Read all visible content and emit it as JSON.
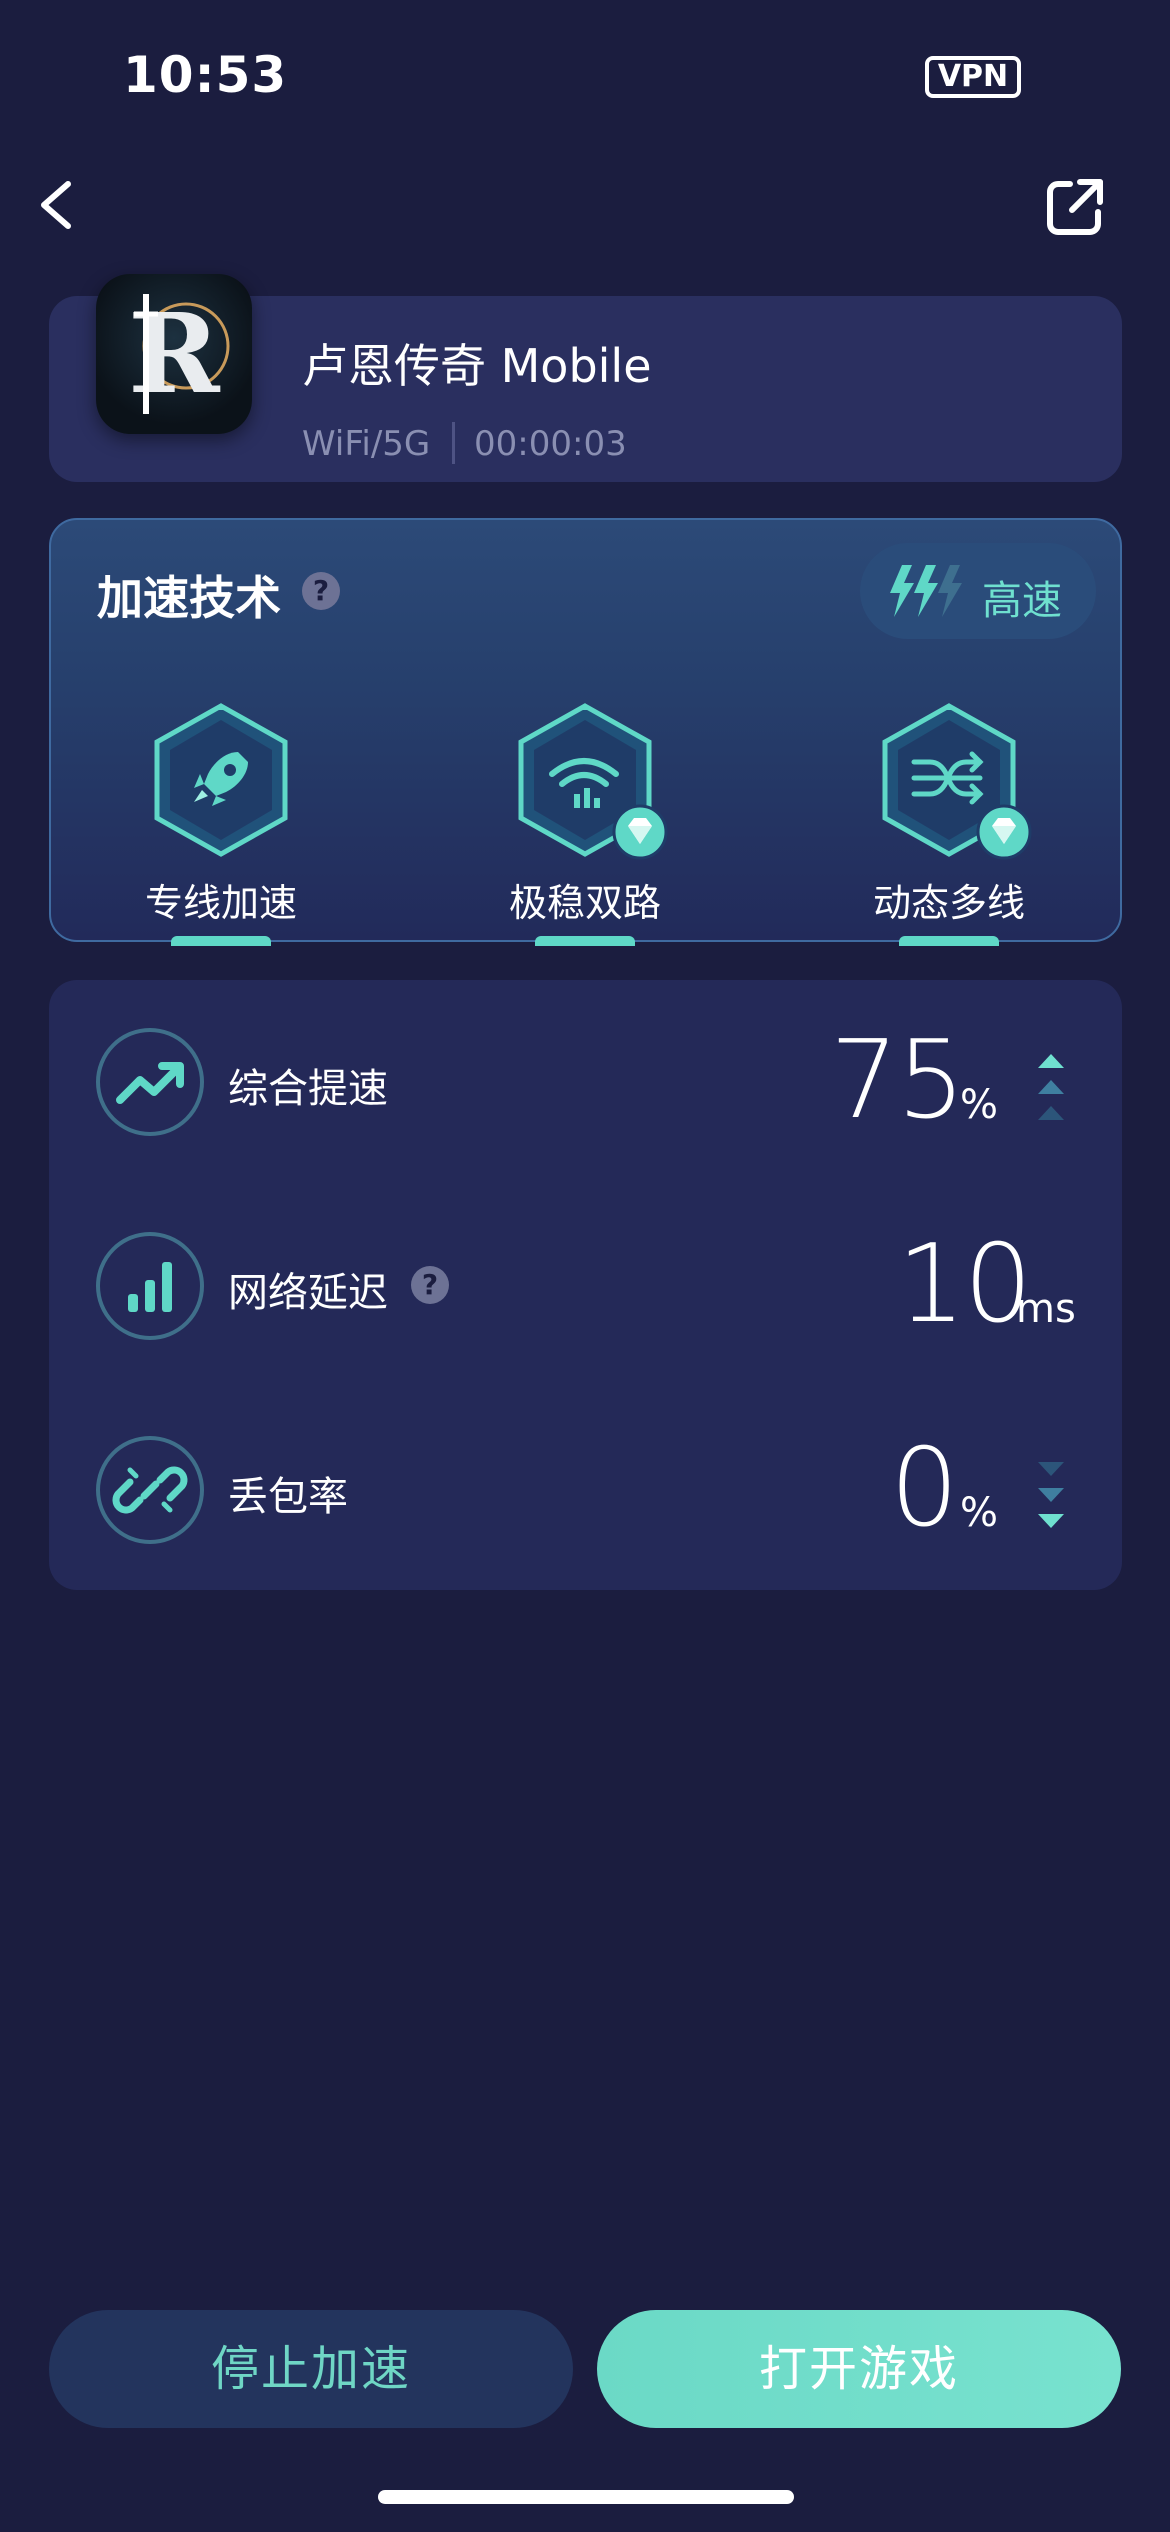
{
  "status_bar": {
    "time": "10:53",
    "vpn": "VPN"
  },
  "nav": {
    "back_icon": "chevron-left-icon",
    "share_icon": "share-external-icon"
  },
  "game": {
    "title": "卢恩传奇 Mobile",
    "network": "WiFi/5G",
    "elapsed": "00:00:03",
    "icon_letter": "R"
  },
  "accel": {
    "title": "加速技术",
    "help": "?",
    "speed_label": "高速",
    "features": [
      {
        "label": "专线加速",
        "icon": "rocket-icon",
        "premium": false
      },
      {
        "label": "极稳双路",
        "icon": "dual-wifi-icon",
        "premium": true
      },
      {
        "label": "动态多线",
        "icon": "shuffle-icon",
        "premium": true
      }
    ]
  },
  "stats": {
    "boost": {
      "label": "综合提速",
      "value": "75",
      "unit": "%",
      "icon": "trend-up-icon"
    },
    "latency": {
      "label": "网络延迟",
      "value": "10",
      "unit": "ms",
      "icon": "signal-bars-icon",
      "help": "?"
    },
    "loss": {
      "label": "丢包率",
      "value": "0",
      "unit": "%",
      "icon": "broken-link-icon"
    }
  },
  "buttons": {
    "stop": "停止加速",
    "open": "打开游戏"
  },
  "colors": {
    "background": "#1b1d3f",
    "accent": "#6fe0cf",
    "card": "#242958"
  }
}
